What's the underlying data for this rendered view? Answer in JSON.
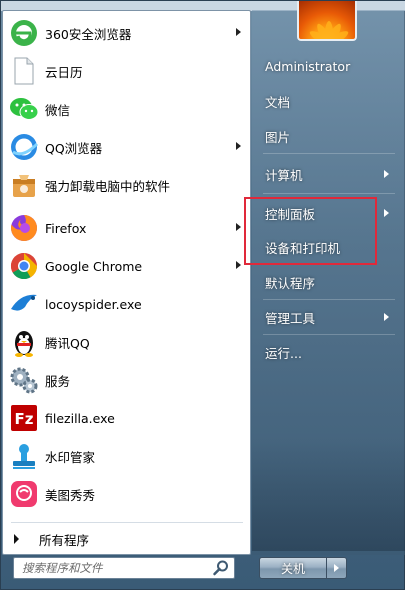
{
  "programs": [
    {
      "label": "360安全浏览器",
      "icon": "360-browser-icon",
      "has_submenu": true
    },
    {
      "label": "云日历",
      "icon": "document-icon",
      "has_submenu": false
    },
    {
      "label": "微信",
      "icon": "wechat-icon",
      "has_submenu": false
    },
    {
      "label": "QQ浏览器",
      "icon": "qq-browser-icon",
      "has_submenu": true
    },
    {
      "label": "强力卸载电脑中的软件",
      "icon": "uninstaller-icon",
      "has_submenu": false
    },
    {
      "label": "Firefox",
      "icon": "firefox-icon",
      "has_submenu": true
    },
    {
      "label": "Google Chrome",
      "icon": "chrome-icon",
      "has_submenu": true
    },
    {
      "label": "locoyspider.exe",
      "icon": "spider-icon",
      "has_submenu": false
    },
    {
      "label": "腾讯QQ",
      "icon": "qq-penguin-icon",
      "has_submenu": false
    },
    {
      "label": "服务",
      "icon": "gears-icon",
      "has_submenu": false
    },
    {
      "label": "filezilla.exe",
      "icon": "filezilla-icon",
      "has_submenu": false
    },
    {
      "label": "水印管家",
      "icon": "stamp-icon",
      "has_submenu": false
    },
    {
      "label": "美图秀秀",
      "icon": "meitu-icon",
      "has_submenu": false
    }
  ],
  "all_programs": "所有程序",
  "search": {
    "placeholder": "搜索程序和文件"
  },
  "right_items": [
    {
      "label": "Administrator",
      "has_submenu": false
    },
    {
      "label": "文档",
      "has_submenu": false
    },
    {
      "label": "图片",
      "has_submenu": false
    },
    {
      "label": "计算机",
      "has_submenu": true
    },
    {
      "label": "控制面板",
      "has_submenu": true
    },
    {
      "label": "设备和打印机",
      "has_submenu": false
    },
    {
      "label": "默认程序",
      "has_submenu": false
    },
    {
      "label": "管理工具",
      "has_submenu": true
    },
    {
      "label": "运行...",
      "has_submenu": false
    }
  ],
  "shutdown": {
    "label": "关机"
  },
  "colors": {
    "highlight": "#e0293a",
    "list_bg": "#ffffff"
  }
}
